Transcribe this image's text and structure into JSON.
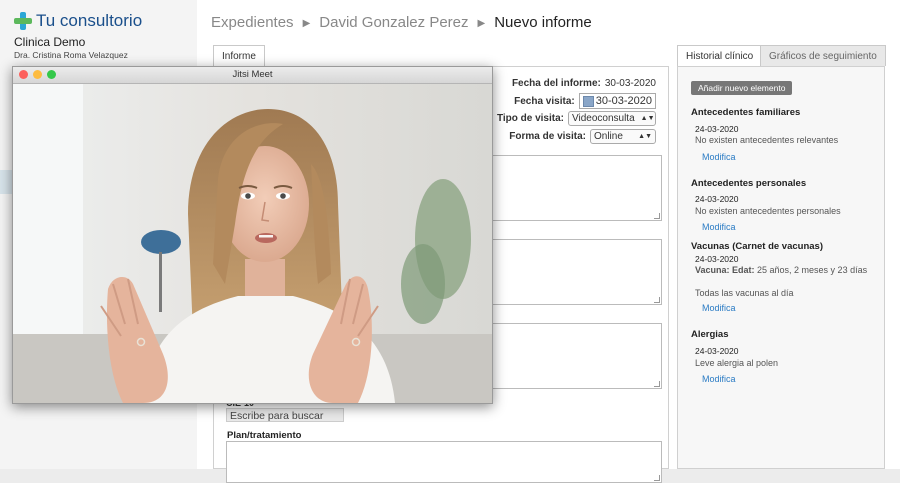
{
  "sidebar": {
    "brand": "Tu consultorio",
    "clinic": "Clinica Demo",
    "doctor": "Dra. Cristina Roma Velazquez"
  },
  "breadcrumb": [
    "Expedientes",
    "David Gonzalez Perez",
    "Nuevo informe"
  ],
  "tabs": {
    "informe": "Informe",
    "historial": "Historial clínico",
    "graficos": "Gráficos de seguimiento"
  },
  "form": {
    "fecha_informe_label": "Fecha del informe:",
    "fecha_informe_value": "30-03-2020",
    "fecha_visita_label": "Fecha visita:",
    "fecha_visita_value": "30-03-2020",
    "tipo_visita_label": "Tipo de visita:",
    "tipo_visita_value": "Videoconsulta",
    "forma_visita_label": "Forma de visita:",
    "forma_visita_value": "Online",
    "cie_label": "CIE-10",
    "search_placeholder": "Escribe para buscar",
    "plan_label": "Plan/tratamiento"
  },
  "historial": {
    "add_button": "Añadir nuevo elemento",
    "sections": [
      {
        "title": "Antecedentes familiares",
        "date": "24-03-2020",
        "text": "No existen antecedentes relevantes",
        "link": "Modifica"
      },
      {
        "title": "Antecedentes personales",
        "date": "24-03-2020",
        "text": "No existen antecedentes personales",
        "link": "Modifica"
      },
      {
        "title": "Vacunas    (Carnet de vacunas)",
        "date": "24-03-2020",
        "text_label": "Vacuna: Edat:",
        "text_value": " 25 años, 2 meses y 23 días",
        "text2": "Todas las vacunas al día",
        "link": "Modifica"
      },
      {
        "title": "Alergias",
        "date": "24-03-2020",
        "text": "Leve alergia al polen",
        "link": "Modifica"
      }
    ]
  },
  "jitsi": {
    "title": "Jitsi Meet"
  },
  "colors": {
    "brand_blue": "#1a4f8b",
    "link_blue": "#2a7bc4",
    "button_gray": "#777777"
  }
}
